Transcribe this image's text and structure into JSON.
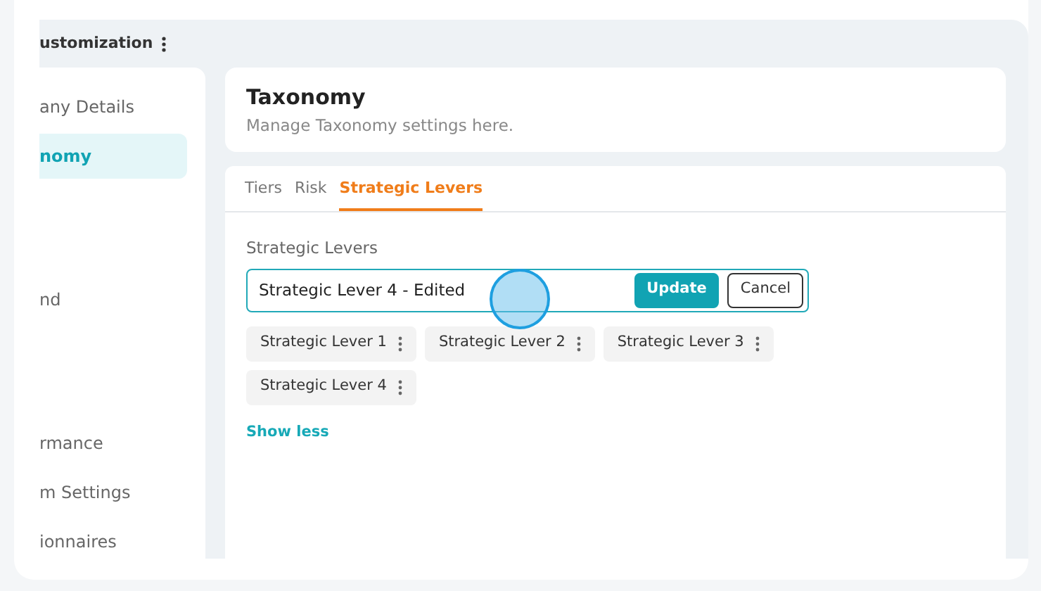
{
  "header": {
    "title": "ustomization"
  },
  "sidebar": {
    "items": [
      {
        "label": "any Details",
        "selected": false
      },
      {
        "label": "nomy",
        "selected": true
      },
      {
        "label": "nd",
        "selected": false
      },
      {
        "label": "rmance",
        "selected": false
      },
      {
        "label": "m Settings",
        "selected": false
      },
      {
        "label": "ionnaires",
        "selected": false
      }
    ]
  },
  "page": {
    "title": "Taxonomy",
    "subtitle": "Manage Taxonomy settings here."
  },
  "tabs": [
    {
      "label": "Tiers",
      "selected": false
    },
    {
      "label": "Risk",
      "selected": false
    },
    {
      "label": "Strategic Levers",
      "selected": true
    }
  ],
  "levers": {
    "label": "Strategic Levers",
    "input": {
      "value": "Strategic Lever 4 - Edited"
    },
    "buttons": [
      {
        "label": "Update",
        "kind": "primary"
      },
      {
        "label": "Cancel",
        "kind": "outline"
      }
    ],
    "items": [
      "Strategic Lever 1",
      "Strategic Lever 2",
      "Strategic Lever 3",
      "Strategic Lever 4"
    ],
    "link": "Show less"
  }
}
